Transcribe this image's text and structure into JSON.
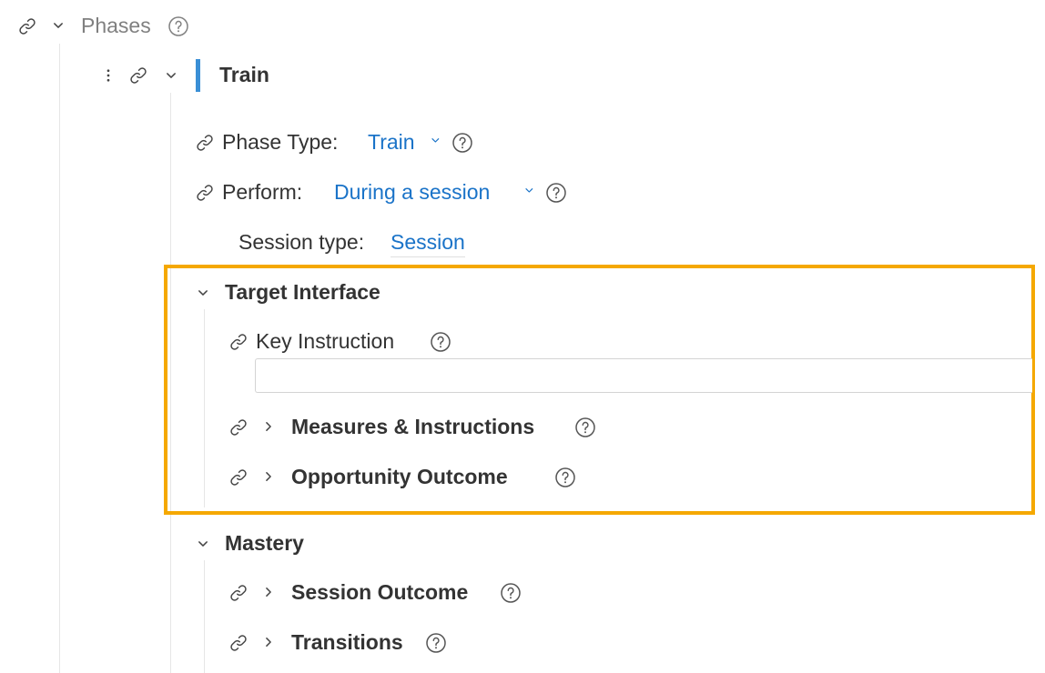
{
  "phases": {
    "label": "Phases"
  },
  "phase": {
    "title": "Train",
    "phase_type": {
      "label": "Phase Type:",
      "value": "Train"
    },
    "perform": {
      "label": "Perform:",
      "value": "During a session"
    },
    "session_type": {
      "label": "Session type:",
      "value": "Session"
    }
  },
  "target_interface": {
    "title": "Target Interface",
    "key_instruction": {
      "label": "Key Instruction",
      "value": ""
    },
    "measures": {
      "label": "Measures & Instructions"
    },
    "opportunity": {
      "label": "Opportunity Outcome"
    }
  },
  "mastery": {
    "title": "Mastery",
    "session_outcome": {
      "label": "Session Outcome"
    },
    "transitions": {
      "label": "Transitions"
    }
  },
  "colors": {
    "accent_bar": "#3a8fd6",
    "link_value": "#1a73c8",
    "highlight_border": "#f5a800"
  }
}
